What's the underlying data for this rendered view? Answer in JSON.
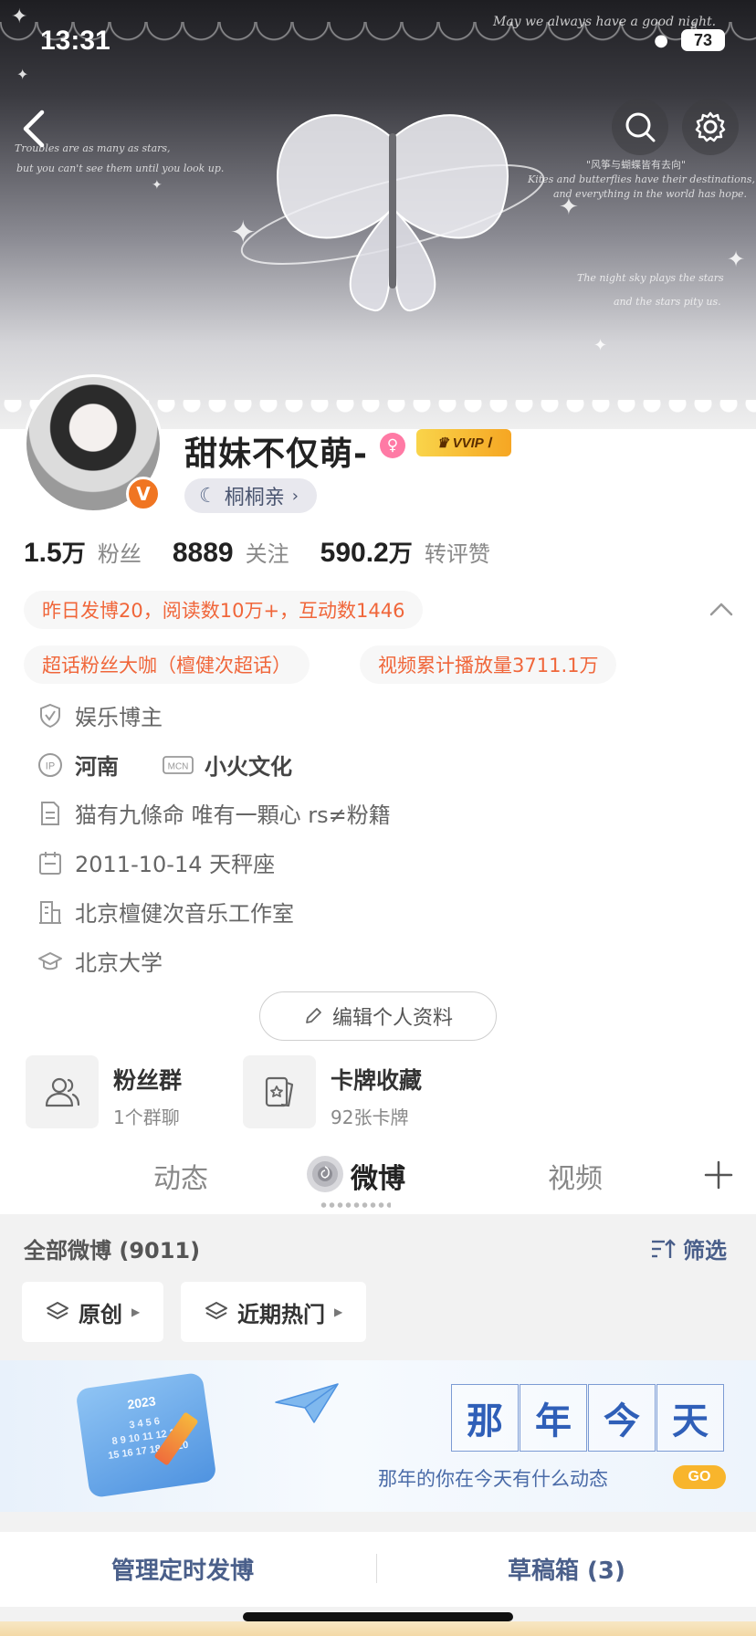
{
  "status_bar": {
    "time": "13:31",
    "battery": "73"
  },
  "banner": {
    "top_right": "May we always have a good night.",
    "left_line1": "Troubles are as many as stars,",
    "left_line2": "but you can't see them until you look up.",
    "right_title": "\"风筝与蝴蝶皆有去向\"",
    "right_line1": "Kites and butterflies have their destinations,",
    "right_line2": "and everything in the world has hope.",
    "right_line3": "The night sky plays the stars",
    "right_line4": "and the stars pity us."
  },
  "profile": {
    "name": "甜妹不仅萌-",
    "vvip": "VVIP Ⅰ",
    "verify_badge": "V",
    "fan_tag": "桐桐亲",
    "stats": [
      {
        "num": "1.5",
        "unit": "万",
        "label": "粉丝"
      },
      {
        "num": "8889",
        "unit": "",
        "label": "关注"
      },
      {
        "num": "590.2",
        "unit": "万",
        "label": "转评赞"
      }
    ],
    "highlight": "昨日发博20，阅读数10万+，互动数1446",
    "super_topic": "超话粉丝大咖（檀健次超话）",
    "video_plays": "视频累计播放量3711.1万",
    "category": "娱乐博主",
    "ip_location": "河南",
    "mcn": "小火文化",
    "bio": "猫有九條命 唯有一顆心 rs≠粉籍",
    "birthday": "2011-10-14 天秤座",
    "company": "北京檀健次音乐工作室",
    "school": "北京大学",
    "edit_button": "编辑个人资料"
  },
  "cards": [
    {
      "title": "粉丝群",
      "sub": "1个群聊",
      "icon": "users-icon"
    },
    {
      "title": "卡牌收藏",
      "sub": "92张卡牌",
      "icon": "card-icon"
    }
  ],
  "tabs": [
    "动态",
    "微博",
    "视频"
  ],
  "feed": {
    "title": "全部微博 (9011)",
    "filter": "筛选",
    "chips": [
      "原创",
      "近期热门"
    ]
  },
  "memory": {
    "chars": [
      "那",
      "年",
      "今",
      "天"
    ],
    "subtitle": "那年的你在今天有什么动态",
    "go": "GO",
    "calendar_year": "2023",
    "calendar_row1": "3 4 5 6",
    "calendar_row2": "8 9 10 11 12 13",
    "calendar_row3": "15 16 17 18 19 20"
  },
  "bottom": {
    "left": "管理定时发博",
    "right": "草稿箱 (3)"
  },
  "colors": {
    "accent_orange": "#f0663a",
    "nav_blue": "#4a5f8a",
    "vvip_gold": "#f6a623"
  }
}
